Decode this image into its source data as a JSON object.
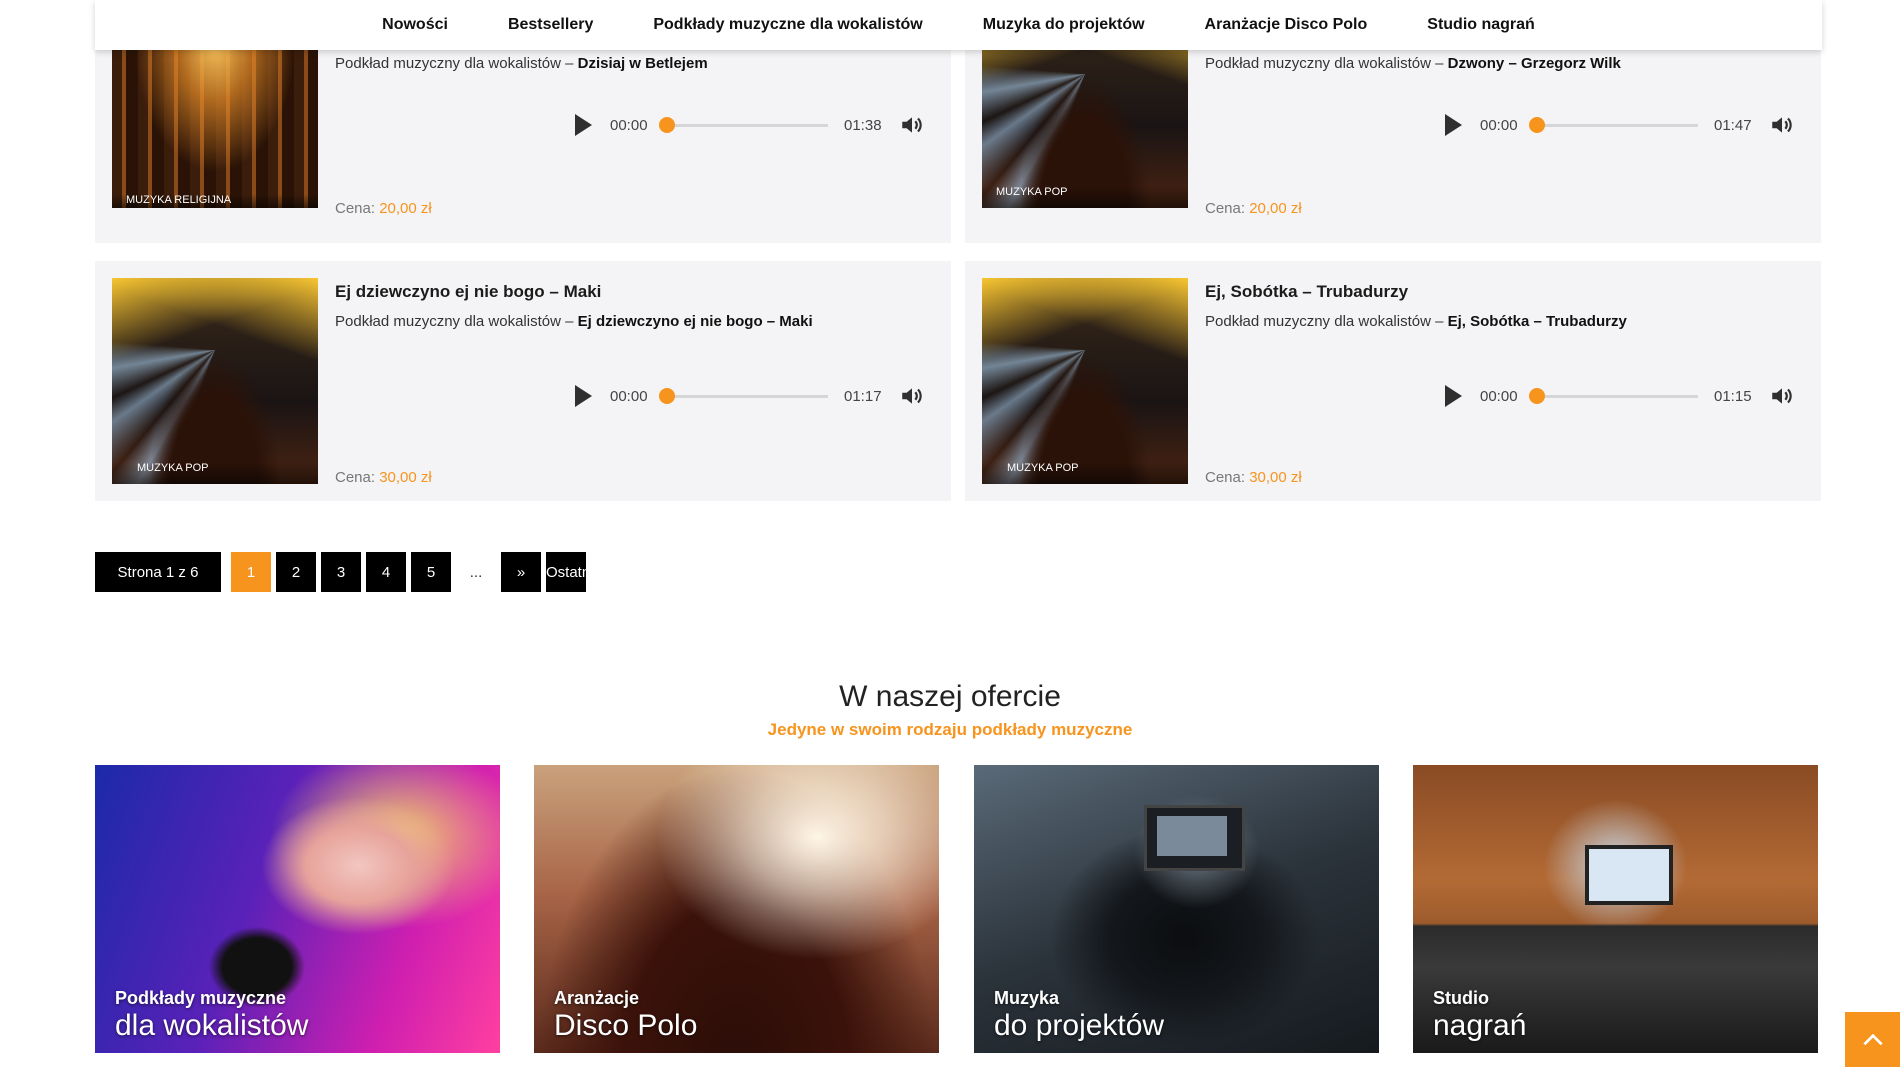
{
  "nav": {
    "items": [
      "Nowości",
      "Bestsellery",
      "Podkłady muzyczne dla wokalistów",
      "Muzyka do projektów",
      "Aranżacje Disco Polo",
      "Studio nagrań"
    ]
  },
  "products": [
    {
      "title": "",
      "desc_prefix": "Podkład muzyczny dla wokalistów – ",
      "desc_name": "Dzisiaj w Betlejem",
      "category": "MUZYKA RELIGIJNA",
      "time_current": "00:00",
      "time_total": "01:38",
      "price_label": "Cena: ",
      "price_value": "20,00 zł",
      "progress": 0
    },
    {
      "title": "",
      "desc_prefix": "Podkład muzyczny dla wokalistów – ",
      "desc_name": "Dzwony – Grzegorz Wilk",
      "category": "MUZYKA POP",
      "time_current": "00:00",
      "time_total": "01:47",
      "price_label": "Cena: ",
      "price_value": "20,00 zł",
      "progress": 0
    },
    {
      "title": "Ej dziewczyno ej nie bogo – Maki",
      "desc_prefix": "Podkład muzyczny dla wokalistów – ",
      "desc_name": "Ej dziewczyno ej nie bogo – Maki",
      "category": "MUZYKA POP",
      "time_current": "00:00",
      "time_total": "01:17",
      "price_label": "Cena: ",
      "price_value": "30,00 zł",
      "progress": 0
    },
    {
      "title": "Ej, Sobótka – Trubadurzy",
      "desc_prefix": "Podkład muzyczny dla wokalistów – ",
      "desc_name": "Ej, Sobótka – Trubadurzy",
      "category": "MUZYKA POP",
      "time_current": "00:00",
      "time_total": "01:15",
      "price_label": "Cena: ",
      "price_value": "30,00 zł",
      "progress": 0
    }
  ],
  "pagination": {
    "info": "Strona 1 z 6",
    "pages": [
      "1",
      "2",
      "3",
      "4",
      "5"
    ],
    "current": "1",
    "dots": "...",
    "next": "»",
    "last": "Ostatnia"
  },
  "offer": {
    "title": "W naszej ofercie",
    "subtitle": "Jedyne w swoim rodzaju podkłady muzyczne",
    "tiles": [
      {
        "line1": "Podkłady muzyczne",
        "line2": "dla wokalistów"
      },
      {
        "line1": "Aranżacje",
        "line2": "Disco Polo"
      },
      {
        "line1": "Muzyka",
        "line2": "do projektów"
      },
      {
        "line1": "Studio",
        "line2": "nagrań"
      }
    ]
  },
  "colors": {
    "accent": "#f7941d",
    "card_bg": "#f4f4f6",
    "pager_bg": "#000000"
  },
  "icons": {
    "play": "play-icon",
    "volume": "volume-icon",
    "scroll_top": "chevron-up-icon"
  }
}
